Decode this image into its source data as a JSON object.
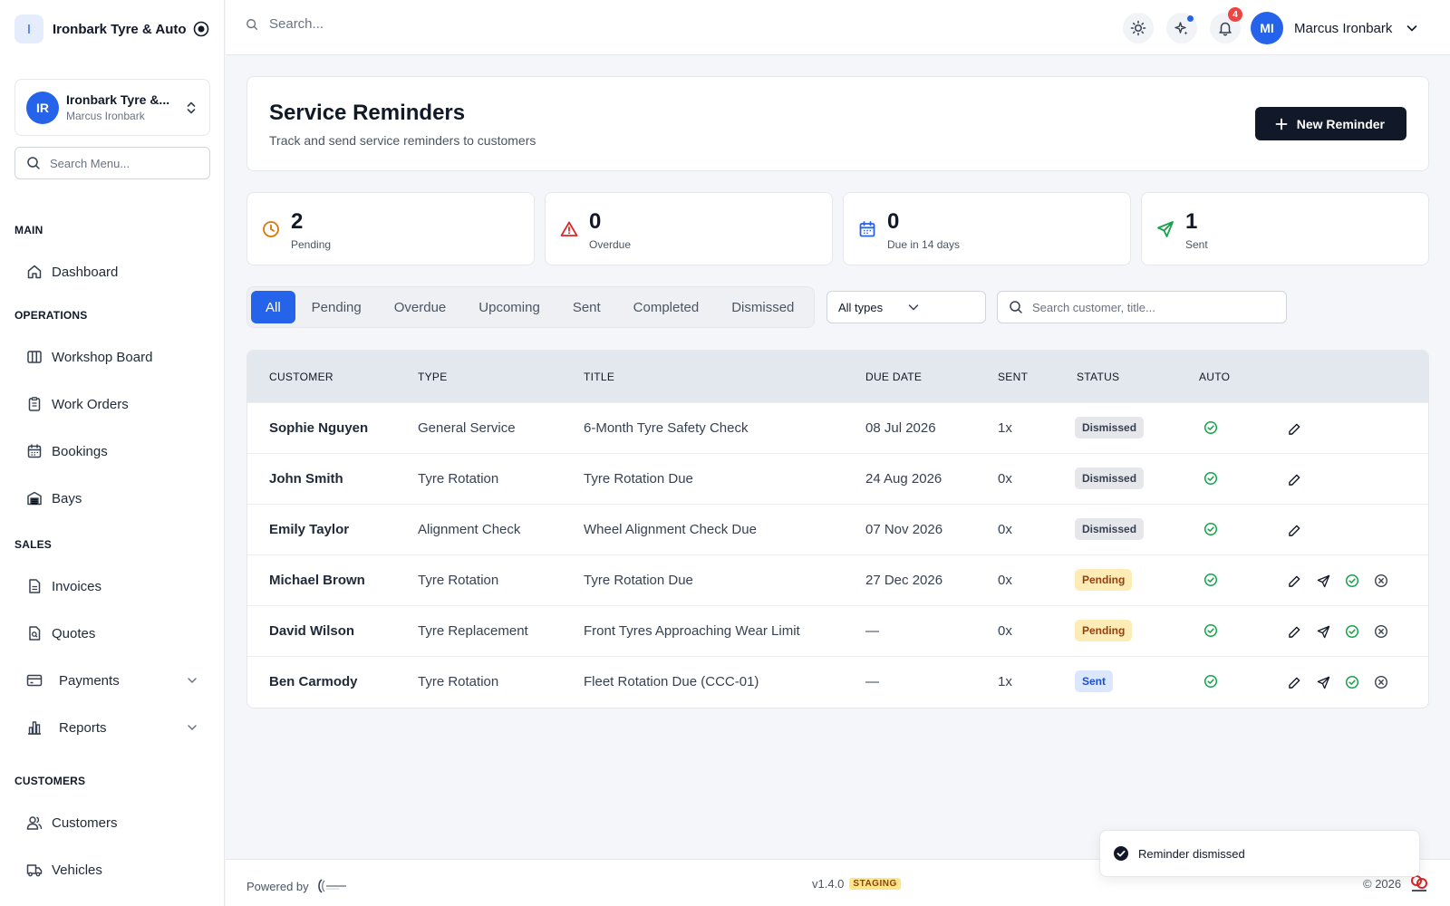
{
  "brand": {
    "logo_letter": "I",
    "name": "Ironbark Tyre & Auto"
  },
  "org": {
    "initials": "IR",
    "name": "Ironbark Tyre &...",
    "user": "Marcus Ironbark"
  },
  "menu_search": {
    "placeholder": "Search Menu..."
  },
  "nav": {
    "main": "MAIN",
    "dashboard": "Dashboard",
    "operations": "OPERATIONS",
    "workshop_board": "Workshop Board",
    "work_orders": "Work Orders",
    "bookings": "Bookings",
    "bays": "Bays",
    "sales": "SALES",
    "invoices": "Invoices",
    "quotes": "Quotes",
    "payments": "Payments",
    "reports": "Reports",
    "customers_section": "CUSTOMERS",
    "customers": "Customers",
    "vehicles": "Vehicles"
  },
  "topbar": {
    "search_placeholder": "Search...",
    "notification_count": "4",
    "user_initials": "MI",
    "user_name": "Marcus Ironbark"
  },
  "page": {
    "title": "Service Reminders",
    "subtitle": "Track and send service reminders to customers",
    "new_button": "New Reminder"
  },
  "stats": [
    {
      "value": "2",
      "label": "Pending",
      "color": "#d97706"
    },
    {
      "value": "0",
      "label": "Overdue",
      "color": "#dc2626"
    },
    {
      "value": "0",
      "label": "Due in 14 days",
      "color": "#2563eb"
    },
    {
      "value": "1",
      "label": "Sent",
      "color": "#16a34a"
    }
  ],
  "tabs": [
    "All",
    "Pending",
    "Overdue",
    "Upcoming",
    "Sent",
    "Completed",
    "Dismissed"
  ],
  "filters": {
    "type_value": "All types",
    "search_placeholder": "Search customer, title..."
  },
  "table": {
    "headers": {
      "customer": "CUSTOMER",
      "type": "TYPE",
      "title": "TITLE",
      "due_date": "DUE DATE",
      "sent": "SENT",
      "status": "STATUS",
      "auto": "AUTO"
    },
    "rows": [
      {
        "customer": "Sophie Nguyen",
        "type": "General Service",
        "title": "6-Month Tyre Safety Check",
        "due_date": "08 Jul 2026",
        "sent": "1x",
        "status": "Dismissed"
      },
      {
        "customer": "John Smith",
        "type": "Tyre Rotation",
        "title": "Tyre Rotation Due",
        "due_date": "24 Aug 2026",
        "sent": "0x",
        "status": "Dismissed"
      },
      {
        "customer": "Emily Taylor",
        "type": "Alignment Check",
        "title": "Wheel Alignment Check Due",
        "due_date": "07 Nov 2026",
        "sent": "0x",
        "status": "Dismissed"
      },
      {
        "customer": "Michael Brown",
        "type": "Tyre Rotation",
        "title": "Tyre Rotation Due",
        "due_date": "27 Dec 2026",
        "sent": "0x",
        "status": "Pending"
      },
      {
        "customer": "David Wilson",
        "type": "Tyre Replacement",
        "title": "Front Tyres Approaching Wear Limit",
        "due_date": "—",
        "sent": "0x",
        "status": "Pending"
      },
      {
        "customer": "Ben Carmody",
        "type": "Tyre Rotation",
        "title": "Fleet Rotation Due (CCC-01)",
        "due_date": "—",
        "sent": "1x",
        "status": "Sent"
      }
    ]
  },
  "footer": {
    "powered_by": "Powered by",
    "version": "v1.4.0",
    "env": "STAGING",
    "copyright": "© 2026"
  },
  "toast": {
    "message": "Reminder dismissed"
  }
}
